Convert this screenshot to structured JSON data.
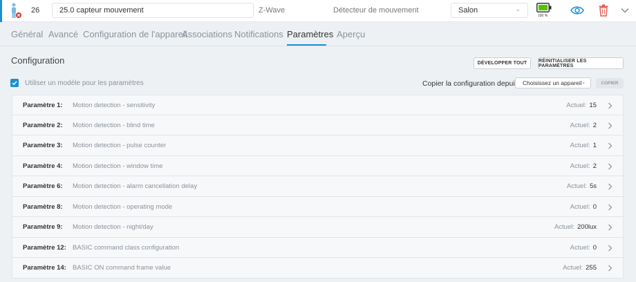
{
  "device": {
    "id": "26",
    "name": "25.0 capteur mouvement",
    "protocol": "Z-Wave",
    "type": "Détecteur de mouvement",
    "room": "Salon",
    "battery": "100 %",
    "colors": {
      "accent": "#1a8fd6",
      "battery": "#55c400",
      "delete": "#e05a4f",
      "error": "#d9342b"
    },
    "icons": [
      "person-icon",
      "error-badge-icon",
      "battery-icon",
      "eye-icon",
      "trash-icon",
      "chevron-down-icon"
    ]
  },
  "tabs": [
    {
      "label": "Général"
    },
    {
      "label": "Avancé"
    },
    {
      "label": "Configuration de l'appareil"
    },
    {
      "label": "Associations"
    },
    {
      "label": "Notifications"
    },
    {
      "label": "Paramètres",
      "active": true
    },
    {
      "label": "Aperçu"
    }
  ],
  "config": {
    "title": "Configuration",
    "expand_all": "Développer tout",
    "reset_params": "Réinitialiser les paramètres",
    "use_template": "Utiliser un modèle pour les paramètres",
    "use_template_checked": true,
    "copy_from_label": "Copier la configuration depuis:",
    "copy_select": "Choisissez un appareil",
    "copy_button": "Copier"
  },
  "params": [
    {
      "label": "Paramètre 1:",
      "desc": "Motion detection - sensitivity",
      "current_label": "Actuel:",
      "value": "15"
    },
    {
      "label": "Paramètre 2:",
      "desc": "Motion detection - blind time",
      "current_label": "Actuel:",
      "value": "2"
    },
    {
      "label": "Paramètre 3:",
      "desc": "Motion detection - pulse counter",
      "current_label": "Actuel:",
      "value": "1"
    },
    {
      "label": "Paramètre 4:",
      "desc": "Motion detection - window time",
      "current_label": "Actuel:",
      "value": "2"
    },
    {
      "label": "Paramètre 6:",
      "desc": "Motion detection - alarm cancellation delay",
      "current_label": "Actuel:",
      "value": "5s"
    },
    {
      "label": "Paramètre 8:",
      "desc": "Motion detection - operating mode",
      "current_label": "Actuel:",
      "value": "0"
    },
    {
      "label": "Paramètre 9:",
      "desc": "Motion detection - night/day",
      "current_label": "Actuel:",
      "value": "200lux"
    },
    {
      "label": "Paramètre 12:",
      "desc": "BASIC command class configuration",
      "current_label": "Actuel:",
      "value": "0"
    },
    {
      "label": "Paramètre 14:",
      "desc": "BASIC ON command frame value",
      "current_label": "Actuel:",
      "value": "255"
    }
  ]
}
